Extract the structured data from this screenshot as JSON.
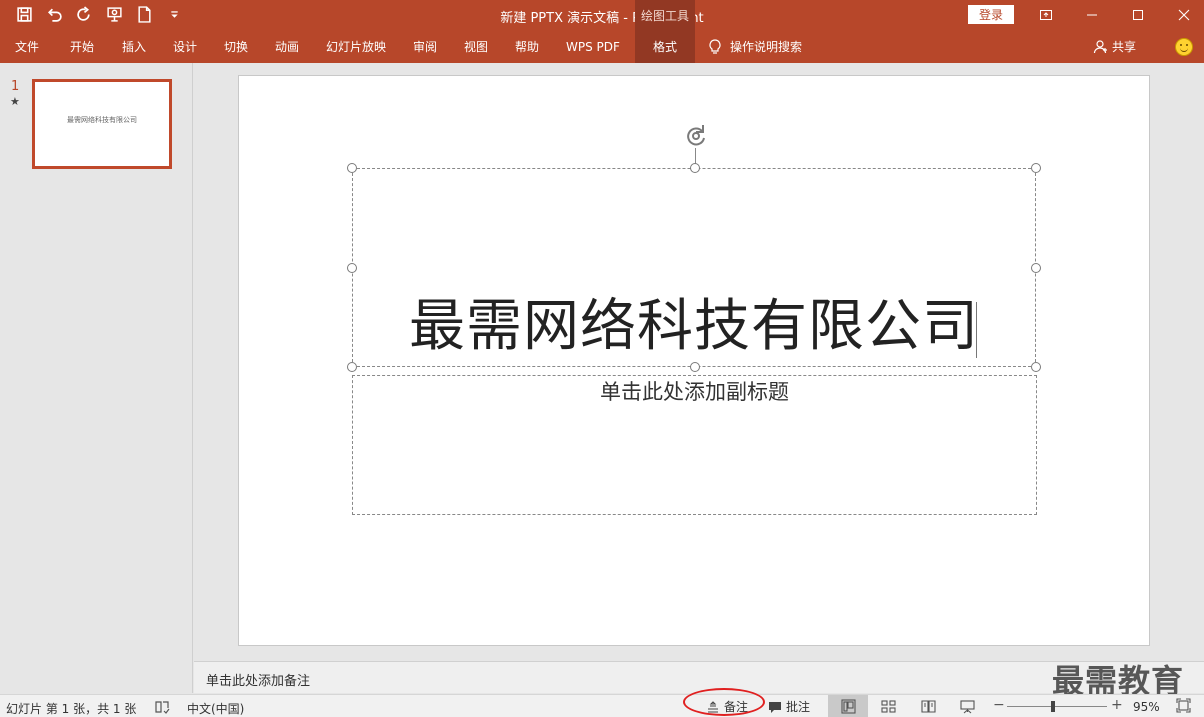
{
  "window": {
    "title": "新建 PPTX 演示文稿  -  PowerPoint",
    "context_tab_group": "绘图工具",
    "login_label": "登录"
  },
  "qat": {
    "icons": [
      "save-icon",
      "undo-icon",
      "redo-icon",
      "present-from-start-icon",
      "new-doc-icon",
      "customize-qat-icon"
    ]
  },
  "ribbon": {
    "tabs": [
      {
        "label": "文件"
      },
      {
        "label": "开始"
      },
      {
        "label": "插入"
      },
      {
        "label": "设计"
      },
      {
        "label": "切换"
      },
      {
        "label": "动画"
      },
      {
        "label": "幻灯片放映"
      },
      {
        "label": "审阅"
      },
      {
        "label": "视图"
      },
      {
        "label": "帮助"
      },
      {
        "label": "WPS PDF"
      },
      {
        "label": "格式"
      }
    ],
    "active_tab": "格式",
    "tell_me": "操作说明搜索",
    "share": "共享"
  },
  "thumbnails": {
    "slides": [
      {
        "number": "1",
        "marker": "★",
        "text": "最需网络科技有限公司"
      }
    ]
  },
  "slide": {
    "title": "最需网络科技有限公司",
    "subtitle_placeholder": "单击此处添加副标题"
  },
  "notes": {
    "placeholder": "单击此处添加备注"
  },
  "watermark": "最需教育",
  "status": {
    "slide_info": "幻灯片 第 1 张，共 1 张",
    "language": "中文(中国)",
    "notes_label": "备注",
    "comments_label": "批注",
    "zoom_minus": "−",
    "zoom_plus": "+",
    "zoom": "95%",
    "zoom_fraction": 0.46
  },
  "colors": {
    "accent": "#b7472a",
    "accent_dark": "#923823",
    "annotation_red": "#e02020"
  }
}
